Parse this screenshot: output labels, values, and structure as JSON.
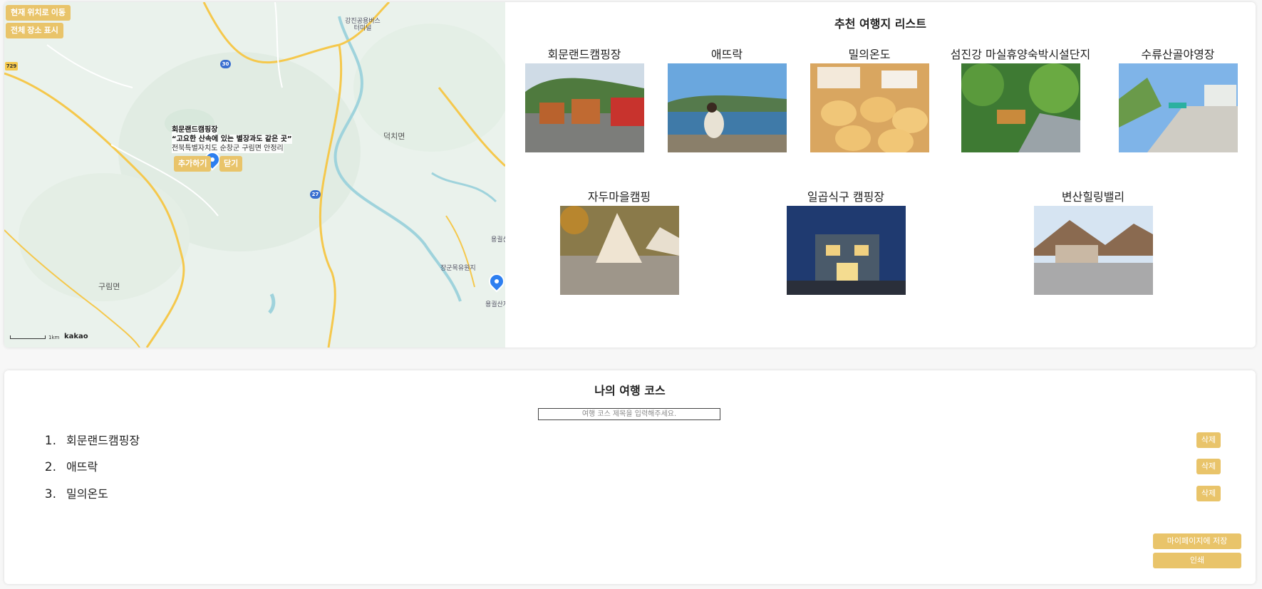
{
  "map": {
    "buttons": {
      "current_location": "현재 위치로 이동",
      "show_all": "전체 장소 표시"
    },
    "labels": [
      "덕치면",
      "구림면",
      "장군목유원지",
      "강진공용버스터미널",
      "용궐산",
      "용궐산자연휴양림"
    ],
    "route_shields": [
      "30",
      "27",
      "729"
    ],
    "info_window": {
      "name": "회문랜드캠핑장",
      "slogan": "“고요한 산속에 있는 별장과도 같은 곳”",
      "address": "전북특별자치도 순창군 구림면 안정리",
      "add_label": "추가하기",
      "close_label": "닫기"
    },
    "scale": "1km",
    "brand": "kakao"
  },
  "recommend": {
    "title": "추천 여행지 리스트",
    "places": [
      {
        "name": "회문랜드캠핑장",
        "photo": "cabins-photo"
      },
      {
        "name": "애뜨락",
        "photo": "lake-photo"
      },
      {
        "name": "밀의온도",
        "photo": "bread-photo"
      },
      {
        "name": "섬진강 마실휴양숙박시설단지",
        "photo": "garden-photo"
      },
      {
        "name": "수류산골야영장",
        "photo": "campsite-photo"
      },
      {
        "name": "자두마을캠핑",
        "photo": "tent-photo"
      },
      {
        "name": "일곱식구 캠핑장",
        "photo": "night-house-photo"
      },
      {
        "name": "변산힐링밸리",
        "photo": "mountain-house-photo"
      }
    ]
  },
  "course": {
    "title": "나의 여행 코스",
    "input_placeholder": "여행 코스 제목을 입력해주세요.",
    "items": [
      {
        "num": "1.",
        "name": "회문랜드캠핑장",
        "delete_label": "삭제"
      },
      {
        "num": "2.",
        "name": "애뜨락",
        "delete_label": "삭제"
      },
      {
        "num": "3.",
        "name": "밀의온도",
        "delete_label": "삭제"
      }
    ],
    "save_label": "마이페이지에 저장",
    "print_label": "인쇄"
  },
  "colors": {
    "accent": "#e9c46a",
    "pin": "#2d7ff0",
    "road": "#f5c84c",
    "river": "#9fd3dc"
  }
}
